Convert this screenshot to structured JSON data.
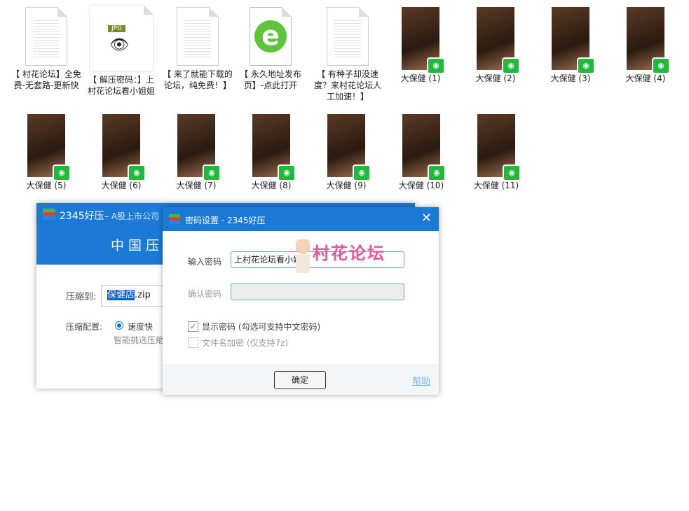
{
  "files_row1": [
    {
      "type": "doc",
      "label": "【 村花论坛】全免费-无套路-更新快"
    },
    {
      "type": "jpg",
      "label": "【 解压密码：】上村花论坛看小姐姐",
      "icon_text": "JPG"
    },
    {
      "type": "doc",
      "label": "【 来了就能下载的论坛，纯免费！】"
    },
    {
      "type": "ie",
      "label": "【 永久地址发布页】-点此打开"
    },
    {
      "type": "doc",
      "label": "【 有种子却没速度？来村花论坛人工加速！】"
    },
    {
      "type": "video",
      "label": "大保健 (1)"
    },
    {
      "type": "video",
      "label": "大保健 (2)"
    },
    {
      "type": "video",
      "label": "大保健 (3)"
    },
    {
      "type": "video",
      "label": "大保健 (4)"
    }
  ],
  "files_row2": [
    {
      "label": "大保健 (5)"
    },
    {
      "label": "大保健 (6)"
    },
    {
      "label": "大保健 (7)"
    },
    {
      "label": "大保健 (8)"
    },
    {
      "label": "大保健 (9)"
    },
    {
      "label": "大保健 (10)"
    },
    {
      "label": "大保健 (11)"
    }
  ],
  "main_window": {
    "title": "2345好压",
    "subtitle": "– A股上市公司",
    "banner": "中国压缩",
    "compress_to_label": "压缩到:",
    "filename_selected": "保健店",
    "filename_ext": ".zip",
    "config_label": "压缩配置:",
    "option": "速度快",
    "option_desc": "智能挑选压缩"
  },
  "password_dialog": {
    "title": "密码设置 - 2345好压",
    "enter_label": "输入密码",
    "password_value": "上村花论坛看小姐姐",
    "confirm_label": "确认密码",
    "show_password": "显示密码 (勾选可支持中文密码)",
    "show_password_checked": true,
    "encrypt_names": "文件名加密 (仅支持7z)",
    "encrypt_names_checked": false,
    "ok": "确定",
    "help": "帮助",
    "watermark": "村花论坛"
  },
  "colors": {
    "accent": "#1a7ad6",
    "badge": "#1fb93c",
    "watermark": "#e8559a"
  }
}
